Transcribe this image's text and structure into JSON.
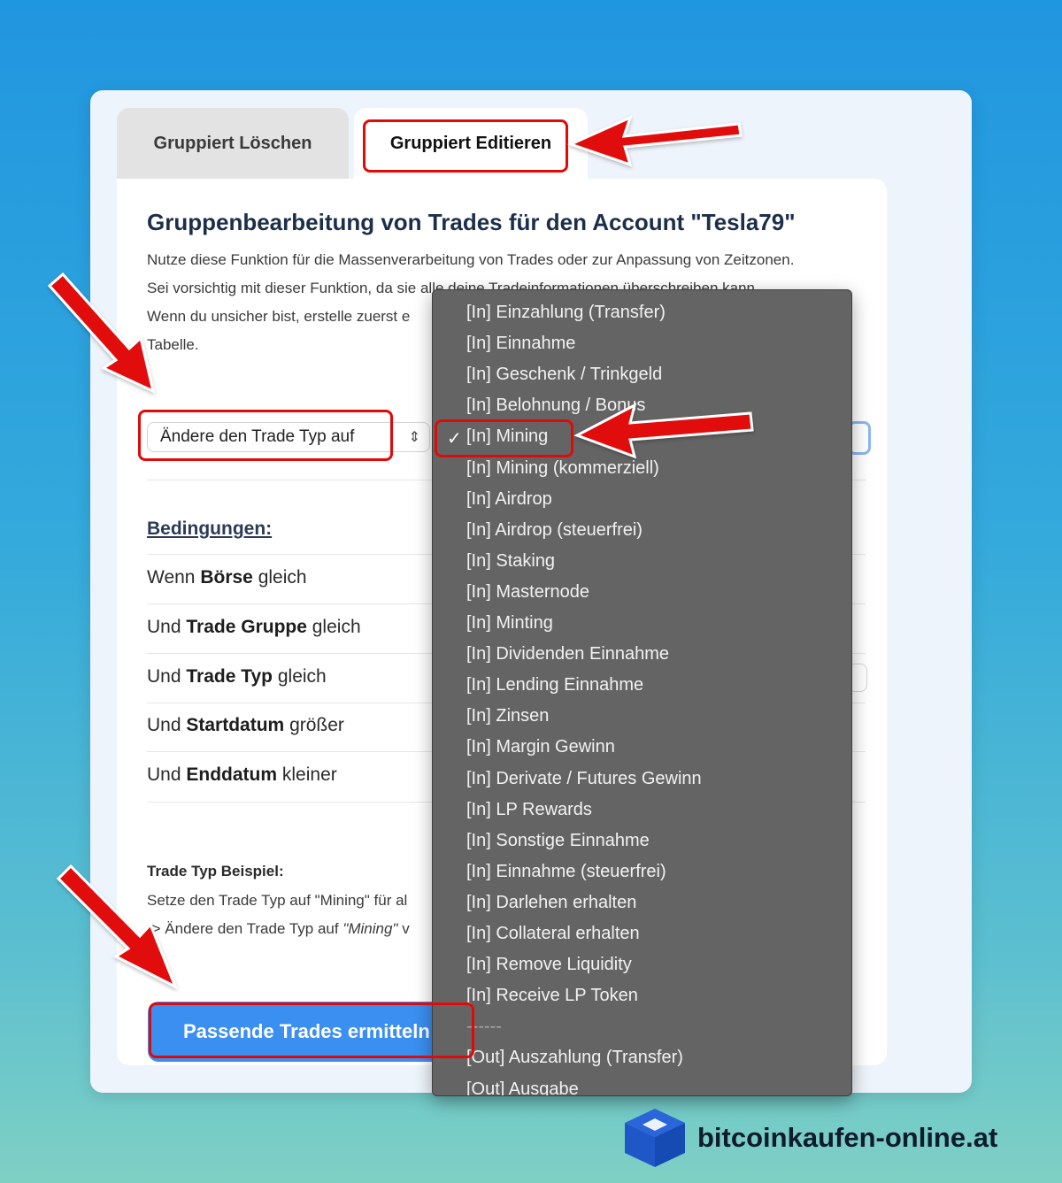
{
  "tabs": [
    {
      "label": "Gruppiert Löschen",
      "active": false
    },
    {
      "label": "Gruppiert Editieren",
      "active": true
    }
  ],
  "panel": {
    "title": "Gruppenbearbeitung von Trades für den Account \"Tesla79\"",
    "intro": [
      "Nutze diese Funktion für die Massenverarbeitung von Trades oder zur Anpassung von Zeitzonen.",
      "Sei vorsichtig mit dieser Funktion, da sie alle deine Tradeinformationen überschreiben kann.",
      "Wenn du unsicher bist, erstelle zuerst e",
      "Tabelle."
    ],
    "action_select": {
      "value": "Ändere den Trade Typ auf"
    },
    "conditions": {
      "heading": "Bedingungen:",
      "rows": [
        {
          "prefix": "Wenn",
          "field": "Börse",
          "op": "gleich"
        },
        {
          "prefix": "Und",
          "field": "Trade Gruppe",
          "op": "gleich"
        },
        {
          "prefix": "Und",
          "field": "Trade Typ",
          "op": "gleich"
        },
        {
          "prefix": "Und",
          "field": "Startdatum",
          "op": "größer"
        },
        {
          "prefix": "Und",
          "field": "Enddatum",
          "op": "kleiner"
        }
      ]
    },
    "example": {
      "heading": "Trade Typ Beispiel:",
      "line1": "Setze den Trade Typ auf \"Mining\" für al",
      "line2_prefix": "-> Ändere den Trade Typ auf ",
      "line2_italic": "\"Mining\"",
      "line2_suffix": " v"
    },
    "submit_button": "Passende Trades ermitteln"
  },
  "dropdown": {
    "selected": "[In] Mining",
    "options": [
      "[In] Einzahlung (Transfer)",
      "[In] Einnahme",
      "[In] Geschenk / Trinkgeld",
      "[In] Belohnung / Bonus",
      "[In] Mining",
      "[In] Mining (kommerziell)",
      "[In] Airdrop",
      "[In] Airdrop (steuerfrei)",
      "[In] Staking",
      "[In] Masternode",
      "[In] Minting",
      "[In] Dividenden Einnahme",
      "[In] Lending Einnahme",
      "[In] Zinsen",
      "[In] Margin Gewinn",
      "[In] Derivate / Futures Gewinn",
      "[In] LP Rewards",
      "[In] Sonstige Einnahme",
      "[In] Einnahme (steuerfrei)",
      "[In] Darlehen erhalten",
      "[In] Collateral erhalten",
      "[In] Remove Liquidity",
      "[In] Receive LP Token",
      "------",
      "[Out] Auszahlung (Transfer)",
      "[Out] Ausgabe"
    ]
  },
  "branding": {
    "site": "bitcoinkaufen-online.at",
    "logo_icon": "cube-box-icon"
  },
  "colors": {
    "highlight": "#e10a0a",
    "button": "#3b8ff0",
    "dropdown_bg": "#646464"
  }
}
